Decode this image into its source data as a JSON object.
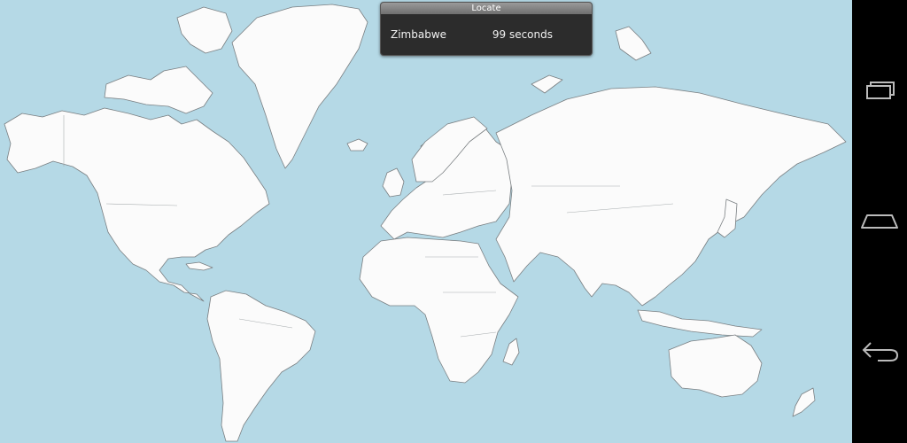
{
  "dialog": {
    "title": "Locate",
    "country": "Zimbabwe",
    "timer": "99 seconds"
  },
  "map": {
    "ocean_color": "#b5d9e6",
    "land_color": "#fbfbfb"
  },
  "navbar": {
    "buttons": [
      "recent-apps-icon",
      "home-icon",
      "back-icon"
    ]
  }
}
